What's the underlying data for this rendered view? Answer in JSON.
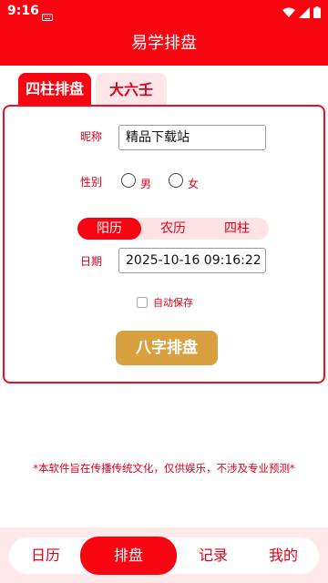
{
  "status_bar": {
    "time": "9:16",
    "icons": [
      "keyboard-icon",
      "wifi-icon",
      "signal-icon",
      "battery-icon"
    ]
  },
  "app_bar": {
    "title": "易学排盘"
  },
  "tabs": [
    {
      "label": "四柱排盘",
      "active": true
    },
    {
      "label": "大六壬",
      "active": false
    }
  ],
  "form": {
    "nickname_label": "昵称",
    "nickname_value": "精品下载站",
    "gender_label": "性别",
    "gender_options": [
      "男",
      "女"
    ],
    "calendar_segments": [
      "阳历",
      "农历",
      "四柱"
    ],
    "calendar_selected": "阳历",
    "date_label": "日期",
    "date_value": "2025-10-16 09:16:22",
    "auto_save_label": "自动保存",
    "auto_save_checked": false,
    "submit_label": "八字排盘"
  },
  "disclaimer": "*本软件旨在传播传统文化，仅供娱乐，不涉及专业预测*",
  "bottom_nav": [
    {
      "label": "日历",
      "active": false
    },
    {
      "label": "排盘",
      "active": true
    },
    {
      "label": "记录",
      "active": false
    },
    {
      "label": "我的",
      "active": false
    }
  ],
  "colors": {
    "primary": "#f70510",
    "accent_gold": "#d9a040",
    "light_pink": "#ffe3e5"
  }
}
